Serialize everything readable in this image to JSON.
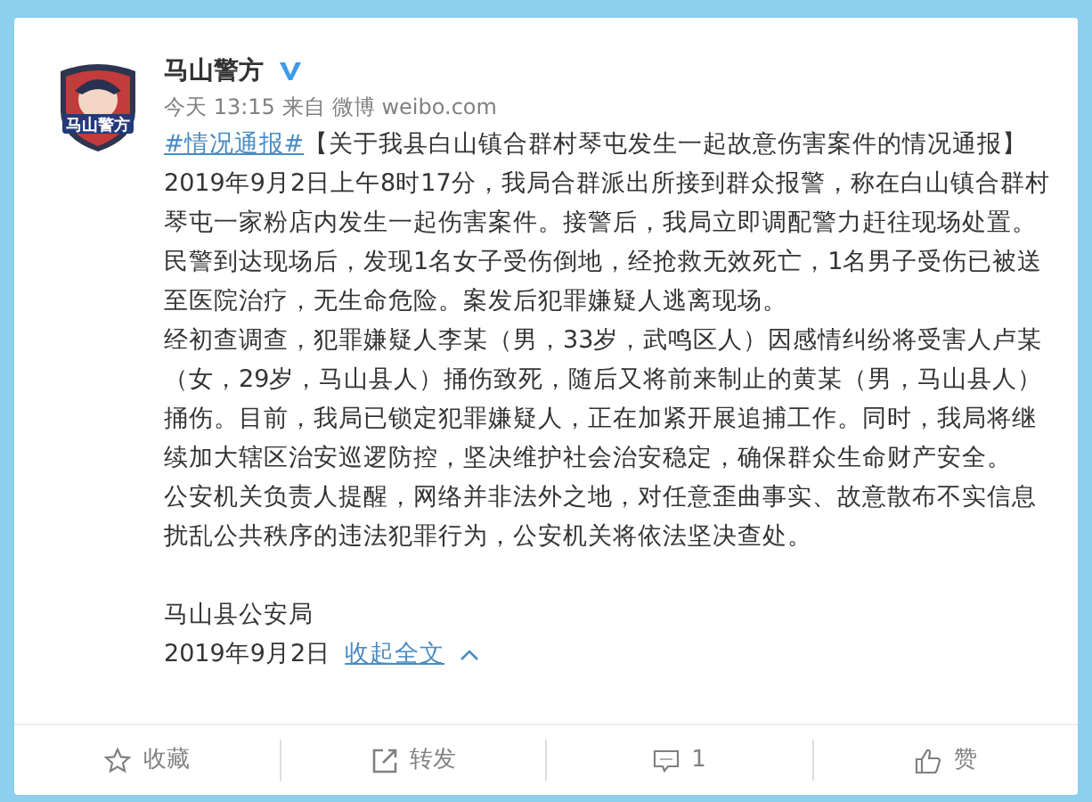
{
  "post": {
    "avatar_label": "马山警方",
    "author": "马山警方",
    "verified": true,
    "time": "今天 13:15",
    "source_prefix": "来自",
    "source": "微博 weibo.com",
    "hashtag": "#情况通报#",
    "headline": "【关于我县白山镇合群村琴屯发生一起故意伤害案件的情况通报】",
    "paragraphs": [
      "2019年9月2日上午8时17分，我局合群派出所接到群众报警，称在白山镇合群村琴屯一家粉店内发生一起伤害案件。接警后，我局立即调配警力赶往现场处置。民警到达现场后，发现1名女子受伤倒地，经抢救无效死亡，1名男子受伤已被送至医院治疗，无生命危险。案发后犯罪嫌疑人逃离现场。",
      "经初查调查，犯罪嫌疑人李某（男，33岁，武鸣区人）因感情纠纷将受害人卢某（女，29岁，马山县人）捅伤致死，随后又将前来制止的黄某（男，马山县人）捅伤。目前，我局已锁定犯罪嫌疑人，正在加紧开展追捕工作。同时，我局将继续加大辖区治安巡逻防控，坚决维护社会治安稳定，确保群众生命财产安全。",
      "公安机关负责人提醒，网络并非法外之地，对任意歪曲事实、故意散布不实信息扰乱公共秩序的违法犯罪行为，公安机关将依法坚决查处。"
    ],
    "signature": "马山县公安局",
    "date": "2019年9月2日",
    "collapse": "收起全文"
  },
  "actions": [
    {
      "kind": "favorite",
      "label": "收藏"
    },
    {
      "kind": "repost",
      "label": "转发"
    },
    {
      "kind": "comment",
      "label": "1"
    },
    {
      "kind": "like",
      "label": "赞"
    }
  ]
}
